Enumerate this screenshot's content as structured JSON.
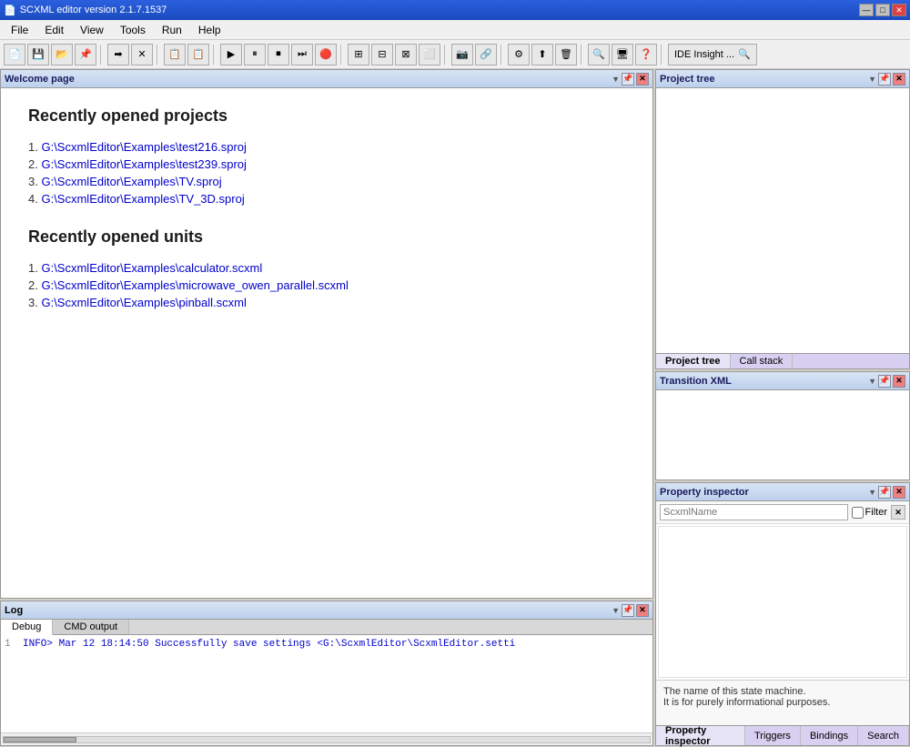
{
  "app": {
    "title": "SCXML editor version 2.1.7.1537",
    "icon": "📄"
  },
  "title_buttons": {
    "minimize": "—",
    "maximize": "□",
    "close": "✕"
  },
  "menu": {
    "items": [
      "File",
      "Edit",
      "View",
      "Tools",
      "Run",
      "Help"
    ]
  },
  "toolbar": {
    "ide_insight_label": "IDE Insight ...",
    "buttons": [
      "📄",
      "💾",
      "📁",
      "📌",
      "➡",
      "✕",
      "📋",
      "📋",
      "▶",
      "⏸",
      "⏹",
      "⏭",
      "🔴",
      "📐",
      "📐",
      "📐",
      "⬜",
      "📷",
      "🔗",
      "🔒",
      "⚙",
      "⬆",
      "🗑",
      "🔍",
      "📺",
      "❓"
    ]
  },
  "welcome_panel": {
    "title": "Welcome page",
    "recent_projects_heading": "Recently opened projects",
    "recent_projects": [
      {
        "num": "1.",
        "path": "G:\\ScxmlEditor\\Examples\\test216.sproj"
      },
      {
        "num": "2.",
        "path": "G:\\ScxmlEditor\\Examples\\test239.sproj"
      },
      {
        "num": "3.",
        "path": "G:\\ScxmlEditor\\Examples\\TV.sproj"
      },
      {
        "num": "4.",
        "path": "G:\\ScxmlEditor\\Examples\\TV_3D.sproj"
      }
    ],
    "recent_units_heading": "Recently opened units",
    "recent_units": [
      {
        "num": "1.",
        "path": "G:\\ScxmlEditor\\Examples\\calculator.scxml"
      },
      {
        "num": "2.",
        "path": "G:\\ScxmlEditor\\Examples\\microwave_owen_parallel.scxml"
      },
      {
        "num": "3.",
        "path": "G:\\ScxmlEditor\\Examples\\pinball.scxml"
      }
    ]
  },
  "log_panel": {
    "title": "Log",
    "tabs": [
      "Debug",
      "CMD output"
    ],
    "active_tab": "Debug",
    "lines": [
      {
        "num": "1",
        "text": "INFO> Mar 12 18:14:50 Successfully save settings <G:\\ScxmlEditor\\ScxmlEditor.setti"
      }
    ]
  },
  "project_tree_panel": {
    "title": "Project tree",
    "tabs": [
      "Project tree",
      "Call stack"
    ]
  },
  "transition_xml_panel": {
    "title": "Transition XML"
  },
  "property_inspector_panel": {
    "title": "Property inspector",
    "filter_placeholder": "ScxmlName",
    "filter_label": "Filter",
    "description_lines": [
      "The name of this state machine.",
      "It is for purely informational purposes."
    ],
    "bottom_tabs": [
      "Property inspector",
      "Triggers",
      "Bindings",
      "Search"
    ]
  }
}
